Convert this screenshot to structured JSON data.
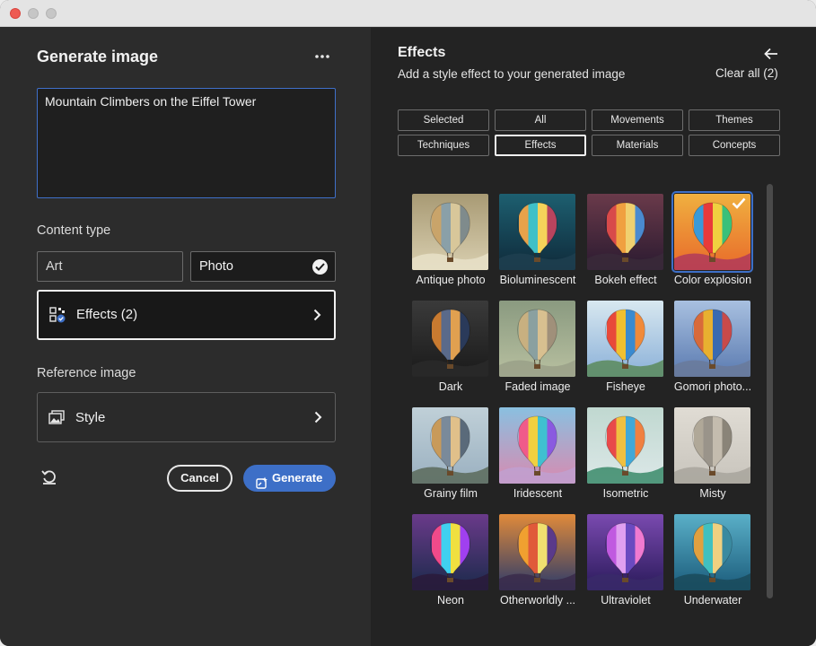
{
  "left": {
    "title": "Generate image",
    "prompt": "Mountain Climbers on the Eiffel Tower",
    "content_type_label": "Content type",
    "content_types": [
      {
        "label": "Art",
        "selected": false
      },
      {
        "label": "Photo",
        "selected": true
      }
    ],
    "effects_button": "Effects (2)",
    "reference_label": "Reference image",
    "style_button": "Style",
    "cancel": "Cancel",
    "generate": "Generate"
  },
  "right": {
    "title": "Effects",
    "subtitle": "Add a style effect to your generated image",
    "clear_all": "Clear all (2)",
    "filters": [
      "Selected",
      "All",
      "Movements",
      "Themes",
      "Techniques",
      "Effects",
      "Materials",
      "Concepts"
    ],
    "active_filter": "Effects",
    "effects": [
      {
        "label": "Antique photo",
        "selected": false
      },
      {
        "label": "Bioluminescent",
        "selected": false
      },
      {
        "label": "Bokeh effect",
        "selected": false
      },
      {
        "label": "Color explosion",
        "selected": true
      },
      {
        "label": "Dark",
        "selected": false
      },
      {
        "label": "Faded image",
        "selected": false
      },
      {
        "label": "Fisheye",
        "selected": false
      },
      {
        "label": "Gomori photo...",
        "selected": false
      },
      {
        "label": "Grainy film",
        "selected": false
      },
      {
        "label": "Iridescent",
        "selected": false
      },
      {
        "label": "Isometric",
        "selected": false
      },
      {
        "label": "Misty",
        "selected": false
      },
      {
        "label": "Neon",
        "selected": false
      },
      {
        "label": "Otherworldly ...",
        "selected": false
      },
      {
        "label": "Ultraviolet",
        "selected": false
      },
      {
        "label": "Underwater",
        "selected": false
      }
    ]
  },
  "colors": {
    "accent": "#3d6fc7",
    "left_bg": "#2c2c2c",
    "right_bg": "#232323"
  }
}
